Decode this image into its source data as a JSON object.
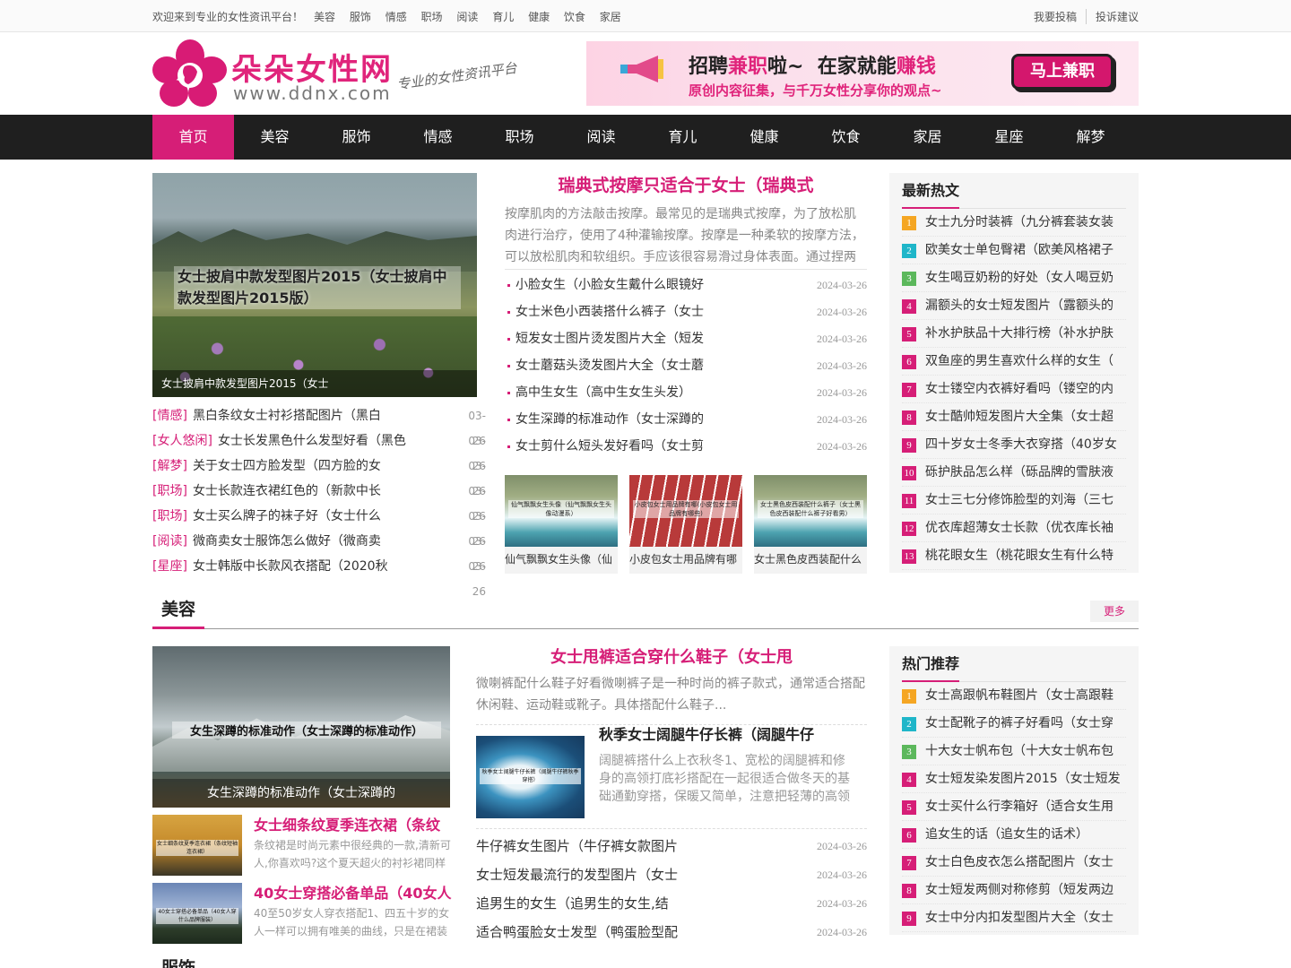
{
  "topbar": {
    "welcome": "欢迎来到专业的女性资讯平台！",
    "links": [
      "美容",
      "服饰",
      "情感",
      "职场",
      "阅读",
      "育儿",
      "健康",
      "饮食",
      "家居"
    ],
    "right": [
      "我要投稿",
      "投诉建议"
    ]
  },
  "logo": {
    "brand": "朵朵女性网",
    "url": "www.ddnx.com",
    "slogan": "专业的女性资讯平台"
  },
  "banner": {
    "line1_a": "招聘",
    "line1_b": "兼职",
    "line1_c": "啦~",
    "line1_d": "在家就能",
    "line1_e": "赚钱",
    "line2": "原创内容征集，与千万女性分享你的观点~",
    "button": "马上兼职"
  },
  "nav": [
    "首页",
    "美容",
    "服饰",
    "情感",
    "职场",
    "阅读",
    "育儿",
    "健康",
    "饮食",
    "家居",
    "星座",
    "解梦"
  ],
  "focus": {
    "overlay": "女士披肩中款发型图片2015（女士披肩中款发型图片2015版）",
    "caption": "女士披肩中款发型图片2015（女士"
  },
  "leftlist": [
    {
      "cat": "[情感]",
      "title": "黑白条纹女士衬衫搭配图片（黑白",
      "date": "03-26"
    },
    {
      "cat": "[女人悠闲]",
      "title": "女士长发黑色什么发型好看（黑色",
      "date": "03-26"
    },
    {
      "cat": "[解梦]",
      "title": "关于女士四方脸发型（四方脸的女",
      "date": "03-26"
    },
    {
      "cat": "[职场]",
      "title": "女士长款连衣裙红色的（新款中长",
      "date": "03-26"
    },
    {
      "cat": "[职场]",
      "title": "女士买么牌子的袜子好（女士什么",
      "date": "03-26"
    },
    {
      "cat": "[阅读]",
      "title": "微商卖女士服饰怎么做好（微商卖",
      "date": "03-26"
    },
    {
      "cat": "[星座]",
      "title": "女士韩版中长款风衣搭配（2020秋",
      "date": "03-26"
    }
  ],
  "headline": {
    "title": "瑞典式按摩只适合于女士（瑞典式",
    "summary": "按摩肌肉的方法敲击按摩。最常见的是瑞典式按摩，为了放松肌肉进行治疗，使用了4种灌输按摩。按摩是一种柔软的按摩方法，可以放松肌肉和软组织。手应该很容易滑过身体表面。通过捏两"
  },
  "midlist": [
    {
      "title": "小脸女生（小脸女生戴什么眼镜好",
      "date": "2024-03-26"
    },
    {
      "title": "女士米色小西装搭什么裤子（女士",
      "date": "2024-03-26"
    },
    {
      "title": "短发女士图片烫发图片大全（短发",
      "date": "2024-03-26"
    },
    {
      "title": "女士蘑菇头烫发图片大全（女士蘑",
      "date": "2024-03-26"
    },
    {
      "title": "高中生女生（高中生女生头发）",
      "date": "2024-03-26"
    },
    {
      "title": "女生深蹲的标准动作（女士深蹲的",
      "date": "2024-03-26"
    },
    {
      "title": "女士剪什么短头发好看吗（女士剪",
      "date": "2024-03-26"
    }
  ],
  "thumbs": [
    {
      "label": "仙气飘飘女生头像（仙气飘飘女生头像动漫系）",
      "title": "仙气飘飘女生头像（仙"
    },
    {
      "label": "小皮包女士用品牌有哪(小皮包女士用品牌有哪些)",
      "title": "小皮包女士用品牌有哪"
    },
    {
      "label": "女士黑色皮西装配什么裤子（女士黑色皮西装配什么裤子好看男）",
      "title": "女士黑色皮西装配什么"
    }
  ],
  "hot": {
    "title": "最新热文",
    "items": [
      "女士九分时装裤（九分裤套装女装",
      "欧美女士单包臀裙（欧美风格裙子",
      "女生喝豆奶粉的好处（女人喝豆奶",
      "漏额头的女士短发图片（露额头的",
      "补水护肤品十大排行榜（补水护肤",
      "双鱼座的男生喜欢什么样的女生（",
      "女士镂空内衣裤好看吗（镂空的内",
      "女士酷帅短发图片大全集（女士超",
      "四十岁女士冬季大衣穿搭（40岁女",
      "砾护肤品怎么样（砾品牌的雪肤液",
      "女士三七分修饰脸型的刘海（三七",
      "优衣库超薄女士长款（优衣库长袖",
      "桃花眼女生（桃花眼女生有什么特"
    ]
  },
  "section2": {
    "name": "美容",
    "more": "更多",
    "big": {
      "overlay": "女生深蹲的标准动作（女士深蹲的标准动作）",
      "caption": "女生深蹲的标准动作（女士深蹲的"
    },
    "minis": [
      {
        "label": "女士细条纹夏季连衣裙（条纹短袖连衣裙）",
        "title": "女士细条纹夏季连衣裙（条纹",
        "text": "条纹裙是时尚元素中很经典的一款,清新可人,你喜欢吗?这个夏天超火的衬衫裙同样"
      },
      {
        "label": "40女士穿搭必备单品（40女人穿什么品牌服装）",
        "title": "40女士穿搭必备单品（40女人",
        "text": "40至50岁女人穿衣搭配1、四五十岁的女人一样可以拥有唯美的曲线，只是在裙装"
      }
    ],
    "headline": {
      "title": "女士甩裤适合穿什么鞋子（女士甩",
      "summary": "微喇裤配什么鞋子好看微喇裤子是一种时尚的裤子款式，通常适合搭配休闲鞋、运动鞋或靴子。具体搭配什么鞋子..."
    },
    "feature": {
      "label": "秋季女士阔腿牛仔长裤（阔腿牛仔裤秋季穿搭）",
      "title": "秋季女士阔腿牛仔长裤（阔腿牛仔",
      "text": "阔腿裤搭什么上衣秋冬1、宽松的阔腿裤和修身的高领打底衫搭配在一起很适合做冬天的基础通勤穿搭，保暖又简单，注意把轻薄的高领"
    },
    "list": [
      {
        "title": "牛仔裤女生图片（牛仔裤女款图片",
        "date": "2024-03-26"
      },
      {
        "title": "女士短发最流行的发型图片（女士",
        "date": "2024-03-26"
      },
      {
        "title": "追男生的女生（追男生的女生,结",
        "date": "2024-03-26"
      },
      {
        "title": "适合鸭蛋脸女士发型（鸭蛋脸型配",
        "date": "2024-03-26"
      }
    ],
    "recommend": {
      "title": "热门推荐",
      "items": [
        "女士高跟帆布鞋图片（女士高跟鞋",
        "女士配靴子的裤子好看吗（女士穿",
        "十大女士帆布包（十大女士帆布包",
        "女士短发染发图片2015（女士短发",
        "女士买什么行李箱好（适合女生用",
        "追女生的话（追女生的话术）",
        "女士白色皮衣怎么搭配图片（女士",
        "女士短发两侧对称修剪（短发两边",
        "女士中分内扣发型图片大全（女士"
      ]
    }
  },
  "next_section": "服饰",
  "colors": {
    "accent": "#d61e77",
    "nav_bg": "#1f1f1f"
  }
}
